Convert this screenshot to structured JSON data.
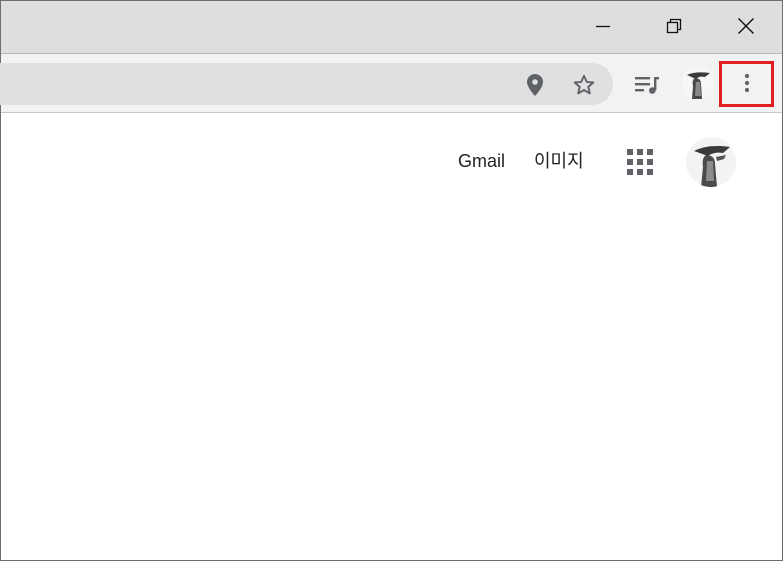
{
  "window": {
    "controls": {
      "minimize_icon": "minimize-icon",
      "restore_icon": "restore-icon",
      "close_icon": "close-icon"
    }
  },
  "toolbar": {
    "location_icon": "location-pin-icon",
    "bookmark_icon": "star-icon",
    "media_icon": "playlist-music-icon",
    "menu_icon": "three-dots-vertical-icon",
    "menu_highlight_color": "#e02020"
  },
  "page": {
    "gmail_label": "Gmail",
    "images_label": "이미지",
    "apps_icon": "apps-grid-icon"
  },
  "colors": {
    "titlebar": "#dedede",
    "toolbar": "#f2f2f2",
    "omnibox": "#e0e0e0",
    "icon": "#5f6368"
  }
}
